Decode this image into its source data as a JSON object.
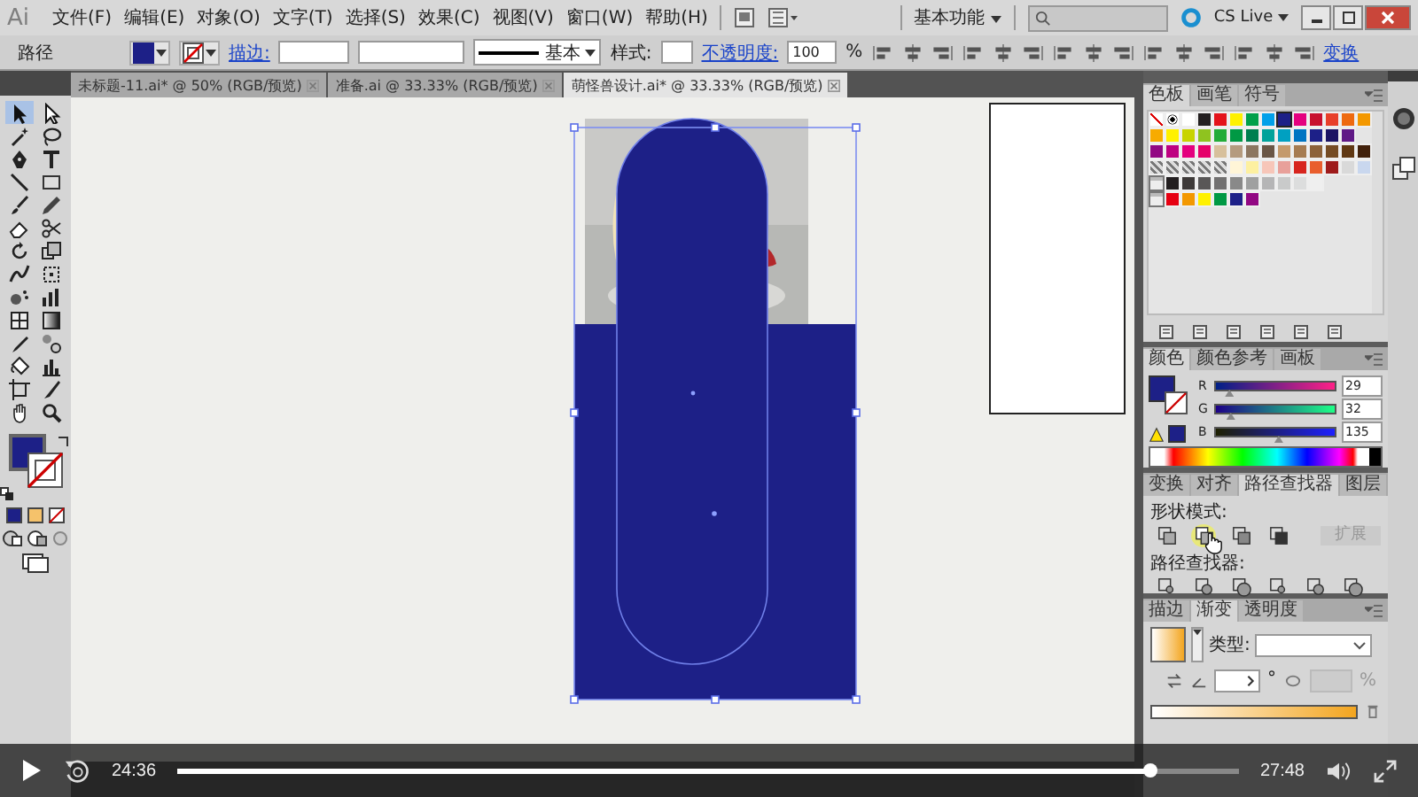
{
  "app_logo": "Ai",
  "menu": [
    "文件(F)",
    "编辑(E)",
    "对象(O)",
    "文字(T)",
    "选择(S)",
    "效果(C)",
    "视图(V)",
    "窗口(W)",
    "帮助(H)"
  ],
  "workspace": "基本功能",
  "cs_live": "CS Live",
  "control_bar": {
    "object_type": "路径",
    "stroke_label": "描边:",
    "stroke_profile": "基本",
    "style_label": "样式:",
    "opacity_label": "不透明度:",
    "opacity": "100",
    "opacity_unit": "%",
    "transform_link": "变换"
  },
  "tabs": [
    {
      "label": "未标题-11.ai* @ 50% (RGB/预览)",
      "selected": false
    },
    {
      "label": "准备.ai @ 33.33% (RGB/预览)",
      "selected": false
    },
    {
      "label": "萌怪兽设计.ai* @ 33.33% (RGB/预览)",
      "selected": true
    }
  ],
  "tools": [
    {
      "selected": true
    },
    {
      "selected": false
    },
    {
      "selected": false
    },
    {
      "selected": false
    },
    {
      "selected": false
    },
    {
      "selected": false
    },
    {
      "selected": false
    },
    {
      "selected": false
    },
    {
      "selected": false
    },
    {
      "selected": false
    },
    {
      "selected": false
    },
    {
      "selected": false
    },
    {
      "selected": false
    },
    {
      "selected": false
    },
    {
      "selected": false
    },
    {
      "selected": false
    },
    {
      "selected": false
    },
    {
      "selected": false
    },
    {
      "selected": false
    },
    {
      "selected": false
    },
    {
      "selected": false
    },
    {
      "selected": false
    },
    {
      "selected": false
    },
    {
      "selected": false
    },
    {
      "selected": false
    },
    {
      "selected": false
    },
    {
      "selected": false
    },
    {
      "selected": false
    }
  ],
  "swatches_panel": {
    "tabs": [
      {
        "label": "色板",
        "selected": true
      },
      {
        "label": "画笔",
        "selected": false
      },
      {
        "label": "符号",
        "selected": false
      }
    ],
    "rows": [
      [
        {
          "kind": "none",
          "selected": false
        },
        {
          "kind": "register",
          "selected": false
        },
        {
          "color": "#ffffff",
          "selected": false
        },
        {
          "color": "#231f20",
          "selected": false
        },
        {
          "color": "#e4131b",
          "selected": false
        },
        {
          "color": "#fff100",
          "selected": false
        },
        {
          "color": "#00a04a",
          "selected": false
        },
        {
          "color": "#00a0e9",
          "selected": false
        },
        {
          "color": "#1d2087",
          "selected": true
        },
        {
          "color": "#e4007f",
          "selected": false
        },
        {
          "color": "#c8102e",
          "selected": false
        },
        {
          "color": "#e8402a",
          "selected": false
        },
        {
          "color": "#ee6a10",
          "selected": false
        },
        {
          "color": "#f39800",
          "selected": false
        }
      ],
      [
        {
          "color": "#f7ab00",
          "selected": false
        },
        {
          "color": "#fff100",
          "selected": false
        },
        {
          "color": "#c8d400",
          "selected": false
        },
        {
          "color": "#8fc31f",
          "selected": false
        },
        {
          "color": "#22ac38",
          "selected": false
        },
        {
          "color": "#009944",
          "selected": false
        },
        {
          "color": "#007e4f",
          "selected": false
        },
        {
          "color": "#00a29a",
          "selected": false
        },
        {
          "color": "#00a0c1",
          "selected": false
        },
        {
          "color": "#0075c2",
          "selected": false
        },
        {
          "color": "#1d2088",
          "selected": false
        },
        {
          "color": "#1b1464",
          "selected": false
        },
        {
          "color": "#601986",
          "selected": false
        }
      ],
      [
        {
          "color": "#920783",
          "selected": false
        },
        {
          "color": "#be0081",
          "selected": false
        },
        {
          "color": "#e4007f",
          "selected": false
        },
        {
          "color": "#e5006a",
          "selected": false
        },
        {
          "color": "#d7c09c",
          "selected": false
        },
        {
          "color": "#b59b7f",
          "selected": false
        },
        {
          "color": "#8c7660",
          "selected": false
        },
        {
          "color": "#6a5645",
          "selected": false
        },
        {
          "color": "#c49a6c",
          "selected": false
        },
        {
          "color": "#a67c52",
          "selected": false
        },
        {
          "color": "#8c6239",
          "selected": false
        },
        {
          "color": "#754c24",
          "selected": false
        },
        {
          "color": "#603813",
          "selected": false
        },
        {
          "color": "#42210b",
          "selected": false
        }
      ],
      [
        {
          "kind": "pattern",
          "selected": false
        },
        {
          "kind": "pattern",
          "selected": false
        },
        {
          "kind": "pattern",
          "selected": false
        },
        {
          "kind": "pattern",
          "selected": false
        },
        {
          "kind": "pattern",
          "selected": false
        },
        {
          "color": "#fff5d7",
          "selected": false
        },
        {
          "color": "#fdf0a0",
          "selected": false
        },
        {
          "color": "#f7c6b9",
          "selected": false
        },
        {
          "color": "#e8a09a",
          "selected": false
        },
        {
          "color": "#d7251e",
          "selected": false
        },
        {
          "color": "#e95e2d",
          "selected": false
        },
        {
          "color": "#9e1b1b",
          "selected": false
        },
        {
          "color": "#d9d9d9",
          "selected": false
        },
        {
          "color": "#c9d7ee",
          "selected": false
        }
      ],
      [
        {
          "kind": "folder",
          "selected": false
        },
        {
          "color": "#231f20",
          "selected": false
        },
        {
          "color": "#3e3a39",
          "selected": false
        },
        {
          "color": "#595757",
          "selected": false
        },
        {
          "color": "#727171",
          "selected": false
        },
        {
          "color": "#898989",
          "selected": false
        },
        {
          "color": "#9fa0a0",
          "selected": false
        },
        {
          "color": "#b5b5b6",
          "selected": false
        },
        {
          "color": "#c9caca",
          "selected": false
        },
        {
          "color": "#dcdddd",
          "selected": false
        },
        {
          "color": "#efefef",
          "selected": false
        }
      ],
      [
        {
          "kind": "folder",
          "selected": false
        },
        {
          "color": "#e60012",
          "selected": false
        },
        {
          "color": "#f39800",
          "selected": false
        },
        {
          "color": "#fff100",
          "selected": false
        },
        {
          "color": "#009944",
          "selected": false
        },
        {
          "color": "#1d2088",
          "selected": false
        },
        {
          "color": "#920783",
          "selected": false
        }
      ]
    ]
  },
  "color_panel": {
    "tabs": [
      {
        "label": "颜色",
        "selected": true
      },
      {
        "label": "颜色参考",
        "selected": false
      },
      {
        "label": "画板",
        "selected": false
      }
    ],
    "channels": [
      {
        "name": "R",
        "level": 0.114,
        "value": "29"
      },
      {
        "name": "G",
        "level": 0.125,
        "value": "32"
      },
      {
        "name": "B",
        "level": 0.529,
        "value": "135"
      }
    ]
  },
  "pathfinder_panel": {
    "tabs": [
      {
        "label": "变换",
        "selected": false
      },
      {
        "label": "对齐",
        "selected": false
      },
      {
        "label": "路径查找器",
        "selected": true
      },
      {
        "label": "图层",
        "selected": false
      }
    ],
    "shape_modes_label": "形状模式:",
    "expand_button": "扩展",
    "pathfinders_label": "路径查找器:"
  },
  "gradient_panel": {
    "tabs": [
      {
        "label": "描边",
        "selected": false
      },
      {
        "label": "渐变",
        "selected": true
      },
      {
        "label": "透明度",
        "selected": false
      }
    ],
    "type_label": "类型:",
    "angle_unit": "°",
    "location_unit": "%"
  },
  "player": {
    "playing": false,
    "current_time": "24:36",
    "level": 0.917,
    "duration": "27:48"
  }
}
